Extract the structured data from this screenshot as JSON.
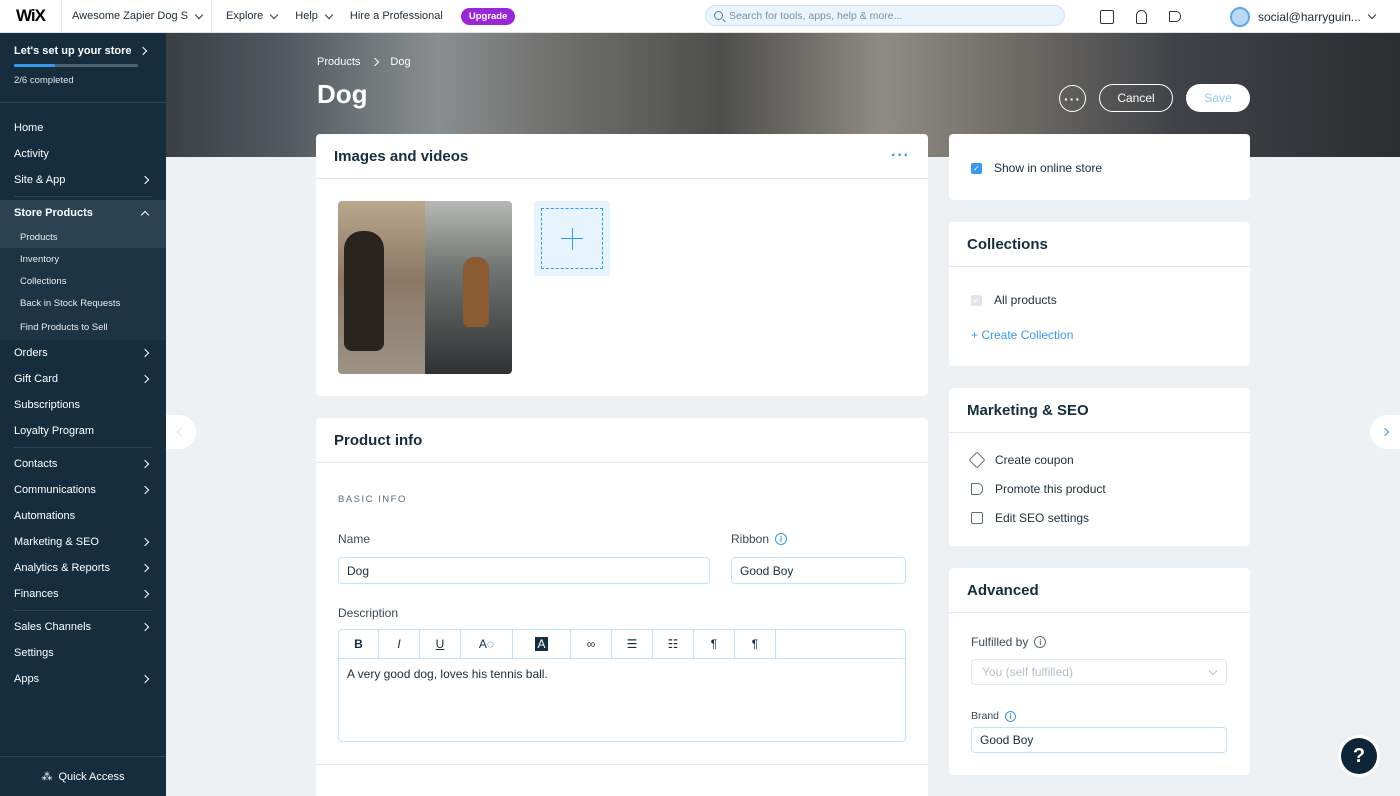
{
  "topbar": {
    "logo": "WiX",
    "site_name": "Awesome Zapier Dog S",
    "nav": [
      "Explore",
      "Help",
      "Hire a Professional"
    ],
    "upgrade": "Upgrade",
    "search_placeholder": "Search for tools, apps, help & more...",
    "user_email": "social@harryguin..."
  },
  "sidebar": {
    "setup_title": "Let's set up your store",
    "setup_progress": "2/6 completed",
    "setup_fraction": 0.333,
    "items_top": [
      "Home",
      "Activity",
      "Site & App"
    ],
    "store_products": {
      "label": "Store Products",
      "subitems": [
        "Products",
        "Inventory",
        "Collections",
        "Back in Stock Requests",
        "Find Products to Sell"
      ]
    },
    "items_mid": [
      "Orders",
      "Gift Card",
      "Subscriptions",
      "Loyalty Program"
    ],
    "items_mid2": [
      "Contacts",
      "Communications",
      "Automations",
      "Marketing & SEO",
      "Analytics & Reports",
      "Finances"
    ],
    "items_bottom": [
      "Sales Channels",
      "Settings",
      "Apps"
    ],
    "quick_access": "Quick Access"
  },
  "header": {
    "breadcrumb": [
      "Products",
      "Dog"
    ],
    "title": "Dog",
    "cancel": "Cancel",
    "save": "Save"
  },
  "images_card": {
    "title": "Images and videos"
  },
  "product_info": {
    "title": "Product info",
    "section": "BASIC INFO",
    "name_label": "Name",
    "name_value": "Dog",
    "ribbon_label": "Ribbon",
    "ribbon_value": "Good Boy",
    "description_label": "Description",
    "description_value": "A very good dog, loves his tennis ball.",
    "toolbar": [
      "B",
      "I",
      "U"
    ]
  },
  "online_store": {
    "label": "Show in online store"
  },
  "collections": {
    "title": "Collections",
    "all_products": "All products",
    "create": "+ Create Collection"
  },
  "marketing": {
    "title": "Marketing & SEO",
    "items": [
      "Create coupon",
      "Promote this product",
      "Edit SEO settings"
    ]
  },
  "advanced": {
    "title": "Advanced",
    "fulfilled_label": "Fulfilled by",
    "fulfilled_value": "You (self fulfilled)",
    "brand_label": "Brand",
    "brand_value": "Good Boy"
  },
  "help": "?",
  "colors": {
    "accent": "#3899ec",
    "sidebar": "#162d3d",
    "upgrade": "#9a27d5"
  }
}
